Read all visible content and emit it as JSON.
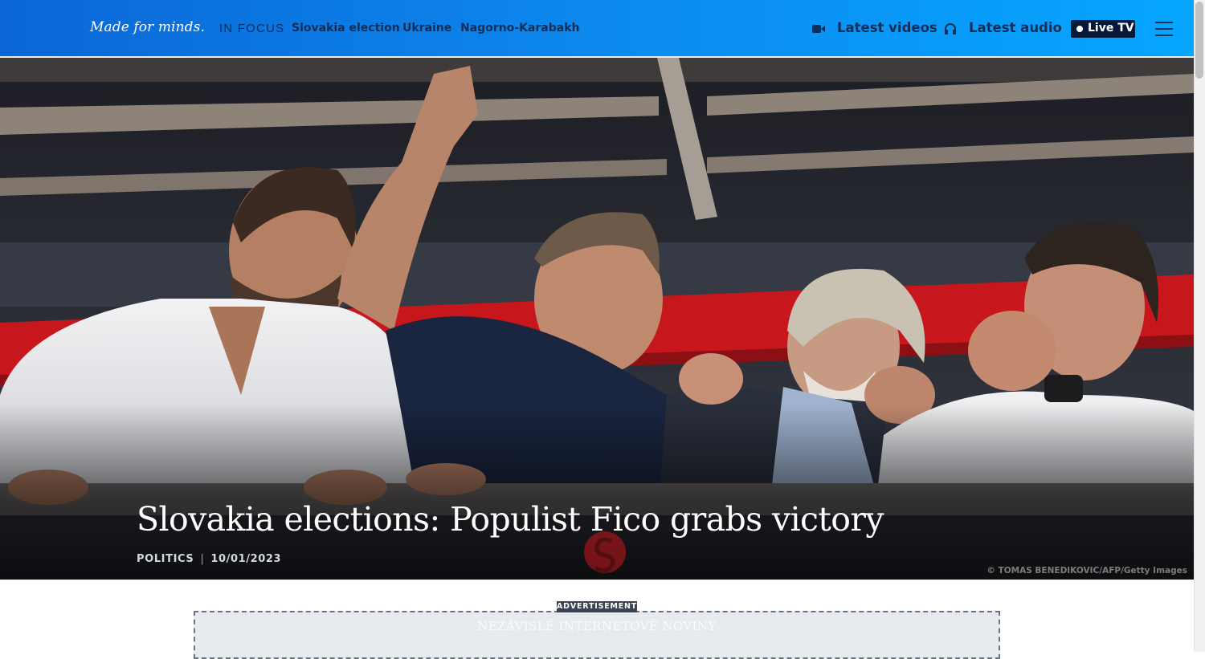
{
  "header": {
    "slogan": "Made for minds.",
    "in_focus_label": "IN FOCUS",
    "focus_links": [
      "Slovakia election",
      "Ukraine",
      "Nagorno-Karabakh"
    ],
    "latest_videos": "Latest videos",
    "latest_audio": "Latest audio",
    "live_tv": "Live TV",
    "colors": {
      "bar_start": "#0a66d6",
      "bar_end": "#05a6ff",
      "text": "#0d2e58",
      "live_bg": "#061a38"
    }
  },
  "hero": {
    "headline": "Slovakia elections: Populist Fico grabs victory",
    "category": "POLITICS",
    "separator": "|",
    "date": "10/01/2023",
    "credit": "© TOMAS BENEDIKOVIC/AFP/Getty Images"
  },
  "ad": {
    "badge": "ADVERTISEMENT",
    "text": "NEZÁVISLÉ INTERNETOVÉ NOVINY"
  }
}
